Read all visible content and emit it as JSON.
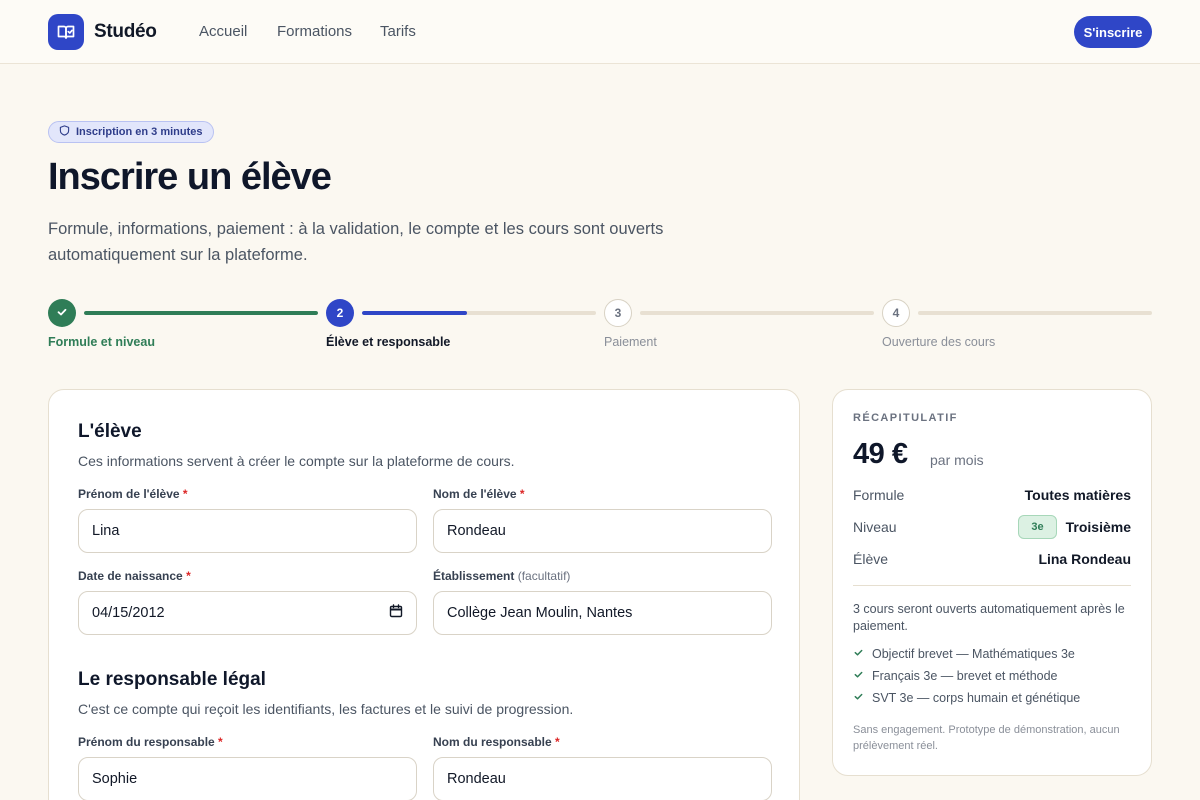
{
  "header": {
    "brand": "Studéo",
    "nav": [
      "Accueil",
      "Formations",
      "Tarifs"
    ],
    "cta": "S'inscrire"
  },
  "hero": {
    "badge": "Inscription en 3 minutes",
    "title": "Inscrire un élève",
    "subtitle": "Formule, informations, paiement : à la validation, le compte et les cours sont ouverts automatiquement sur la plateforme."
  },
  "stepper": {
    "steps": [
      {
        "number": "1",
        "label": "Formule et niveau",
        "state": "done",
        "progress": 1.0
      },
      {
        "number": "2",
        "label": "Élève et responsable",
        "state": "active",
        "progress": 0.45
      },
      {
        "number": "3",
        "label": "Paiement",
        "state": "todo",
        "progress": 0
      },
      {
        "number": "4",
        "label": "Ouverture des cours",
        "state": "todo",
        "progress": 0
      }
    ]
  },
  "form": {
    "student": {
      "title": "L'élève",
      "description": "Ces informations servent à créer le compte sur la plateforme de cours.",
      "first_name": {
        "label": "Prénom de l'élève",
        "required": "*",
        "value": "Lina"
      },
      "last_name": {
        "label": "Nom de l'élève",
        "required": "*",
        "value": "Rondeau"
      },
      "birth_date": {
        "label": "Date de naissance",
        "required": "*",
        "value": "04/15/2012"
      },
      "school": {
        "label": "Établissement",
        "optional": "(facultatif)",
        "value": "Collège Jean Moulin, Nantes"
      }
    },
    "guardian": {
      "title": "Le responsable légal",
      "description": "C'est ce compte qui reçoit les identifiants, les factures et le suivi de progression.",
      "first_name": {
        "label": "Prénom du responsable",
        "required": "*",
        "value": "Sophie"
      },
      "last_name": {
        "label": "Nom du responsable",
        "required": "*",
        "value": "Rondeau"
      }
    }
  },
  "summary": {
    "label": "RÉCAPITULATIF",
    "price": "49 €",
    "period": "par mois",
    "rows": [
      {
        "key": "Formule",
        "value": "Toutes matières"
      },
      {
        "key": "Niveau",
        "value": "Troisième",
        "badge": "3e"
      },
      {
        "key": "Élève",
        "value": "Lina Rondeau"
      }
    ],
    "note": "3 cours seront ouverts automatiquement après le paiement.",
    "courses": [
      "Objectif brevet — Mathématiques 3e",
      "Français 3e — brevet et méthode",
      "SVT 3e — corps humain et génétique"
    ],
    "fine_print": "Sans engagement. Prototype de démonstration, aucun prélèvement réel."
  },
  "colors": {
    "accent": "#2f46c7",
    "success": "#2f7d57",
    "background": "#fbf8f1",
    "required": "#dc2626"
  },
  "icons": {
    "logo": "book-open-icon",
    "badge": "shield-icon",
    "step_done": "check-icon",
    "course": "check-icon",
    "date": "calendar-icon"
  }
}
